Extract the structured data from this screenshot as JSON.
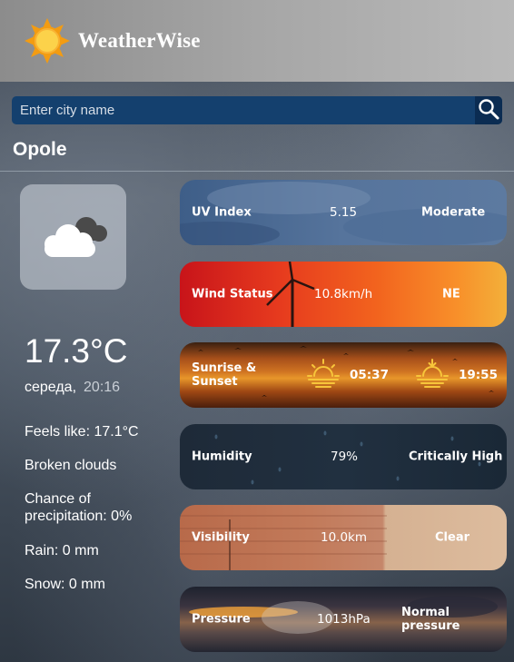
{
  "app": {
    "title": "WeatherWise"
  },
  "search": {
    "placeholder": "Enter city name"
  },
  "location": {
    "city": "Opole"
  },
  "current": {
    "temperature": "17.3°C",
    "day": "середа,",
    "time": "20:16",
    "feels_like": "Feels like: 17.1°C",
    "description": "Broken clouds",
    "precipitation_line1": "Chance of",
    "precipitation_line2": "precipitation: 0%",
    "rain": "Rain: 0 mm",
    "snow": "Snow: 0 mm"
  },
  "cards": {
    "uv": {
      "label": "UV Index",
      "value": "5.15",
      "status": "Moderate"
    },
    "wind": {
      "label": "Wind Status",
      "value": "10.8km/h",
      "status": "NE"
    },
    "sun": {
      "label_line1": "Sunrise &",
      "label_line2": "Sunset",
      "sunrise": "05:37",
      "sunset": "19:55"
    },
    "humidity": {
      "label": "Humidity",
      "value": "79%",
      "status": "Critically High"
    },
    "visibility": {
      "label": "Visibility",
      "value": "10.0km",
      "status": "Clear"
    },
    "pressure": {
      "label": "Pressure",
      "value": "1013hPa",
      "status": "Normal pressure"
    }
  },
  "icons": {
    "logo": "sun-icon",
    "search": "search-icon",
    "weather": "broken-clouds-icon",
    "sunrise": "sunrise-icon",
    "sunset": "sunset-icon"
  },
  "colors": {
    "header": "#a6a6a6",
    "search_bar": "#14406e",
    "accent_sun": "#f5a623"
  }
}
